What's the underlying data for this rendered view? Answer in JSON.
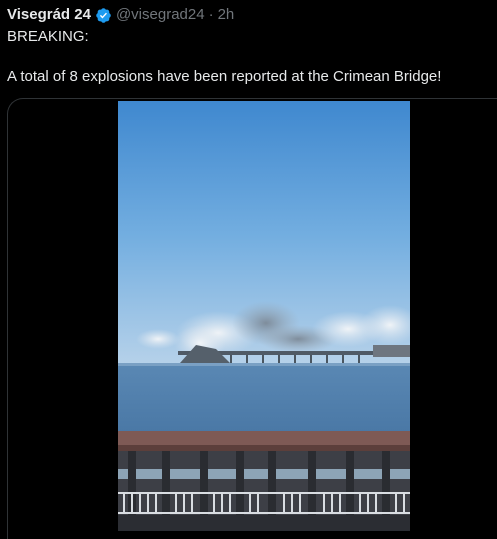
{
  "tweet": {
    "author_name": "Visegrád 24",
    "handle": "@visegrad24",
    "separator": "·",
    "time": "2h",
    "text_line1": "BREAKING:",
    "text_line2": "A total of 8 explosions have been reported at the Crimean Bridge!",
    "verified_icon": "verified-badge-icon"
  },
  "colors": {
    "background": "#000000",
    "text": "#e7e9ea",
    "muted": "#71767b",
    "verified": "#1d9bf0",
    "border": "#2f3336"
  }
}
